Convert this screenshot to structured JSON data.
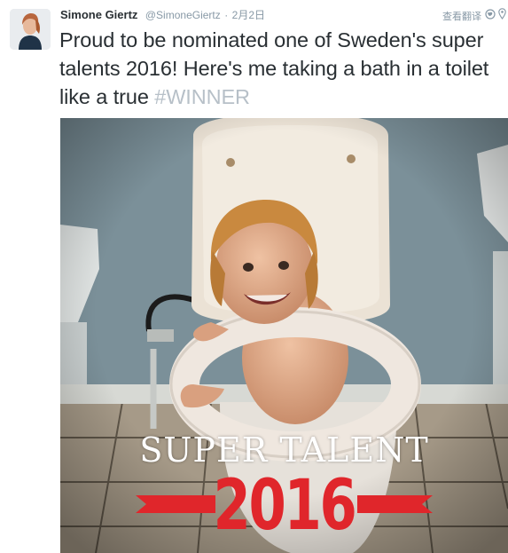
{
  "tweet": {
    "author_name": "Simone Giertz",
    "author_handle": "@SimoneGiertz",
    "separator": "·",
    "date": "2月2日",
    "translate_label": "查看翻译",
    "icons": [
      "globe-icon",
      "location-pin-icon"
    ],
    "text": "Proud to be nominated one of Sweden's super talents 2016! Here's me taking a bath in a toilet like a true ",
    "hashtag": "#WINNER",
    "colors": {
      "name": "#292f33",
      "meta": "#8899a6",
      "hashtag": "#b7c0c8",
      "overlay_red": "#e0262b"
    }
  },
  "media": {
    "overlay_title": "SUPER TALENT",
    "overlay_year": "2016"
  }
}
